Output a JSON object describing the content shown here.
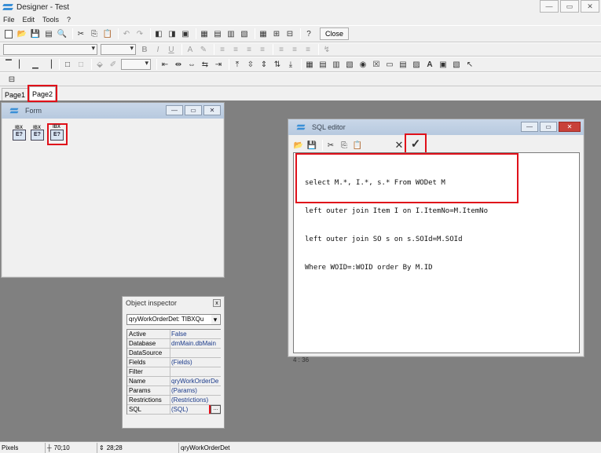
{
  "window": {
    "title": "Designer - Test",
    "controls": {
      "minimize": "—",
      "maximize": "▭",
      "close": "✕"
    }
  },
  "menu": [
    "File",
    "Edit",
    "Tools",
    "?"
  ],
  "toolbar": {
    "close_label": "Close"
  },
  "tabs": [
    {
      "label": "Page1"
    },
    {
      "label": "Page2"
    }
  ],
  "form_window": {
    "title": "Form",
    "component_label": "E?",
    "component_caption": "IBX"
  },
  "sql_editor": {
    "title": "SQL editor",
    "lines": [
      "select M.*, I.*, s.* From WODet M",
      "left outer join Item I on I.ItemNo=M.ItemNo",
      "left outer join SO s on s.SOId=M.SOId",
      "Where WOID=:WOID order By M.ID"
    ],
    "cursor_pos": "4 : 36",
    "ok_icon": "✓",
    "cancel_icon": "✕"
  },
  "object_inspector": {
    "title": "Object inspector",
    "close_glyph": "x",
    "selected_object": "qryWorkOrderDet: TIBXQu",
    "ellipsis": "...",
    "properties": [
      {
        "name": "Active",
        "value": "False"
      },
      {
        "name": "Database",
        "value": "dmMain.dbMain"
      },
      {
        "name": "DataSource",
        "value": ""
      },
      {
        "name": "Fields",
        "value": "(Fields)"
      },
      {
        "name": "Filter",
        "value": ""
      },
      {
        "name": "Name",
        "value": "qryWorkOrderDe"
      },
      {
        "name": "Params",
        "value": "(Params)"
      },
      {
        "name": "Restrictions",
        "value": "(Restrictions)"
      },
      {
        "name": "SQL",
        "value": "(SQL)"
      }
    ]
  },
  "statusbar": {
    "units": "Pixels",
    "position": "70;10",
    "size": "28;28",
    "selected": "qryWorkOrderDet"
  },
  "colors": {
    "highlight": "#e0101a",
    "title_gradient": "#c9d7e8"
  }
}
